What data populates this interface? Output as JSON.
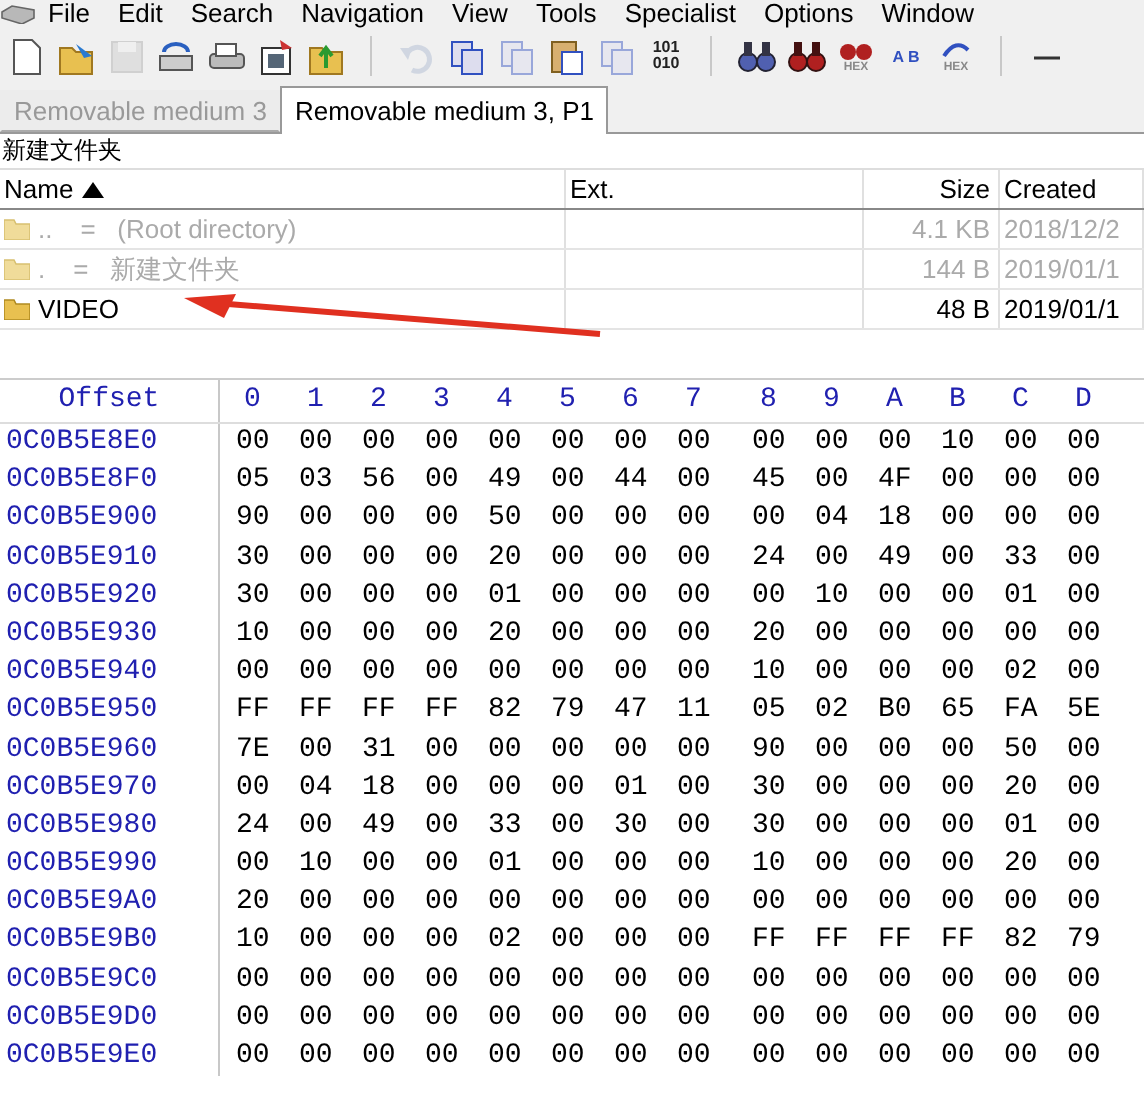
{
  "menu": [
    "File",
    "Edit",
    "Search",
    "Navigation",
    "View",
    "Tools",
    "Specialist",
    "Options",
    "Window"
  ],
  "toolbar": [
    {
      "kind": "new-file",
      "disabled": false
    },
    {
      "kind": "open-folder",
      "disabled": false
    },
    {
      "kind": "save",
      "disabled": true
    },
    {
      "kind": "disk",
      "disabled": false
    },
    {
      "kind": "print",
      "disabled": false
    },
    {
      "kind": "properties",
      "disabled": false
    },
    {
      "kind": "export-folder",
      "disabled": false
    },
    {
      "kind": "separator"
    },
    {
      "kind": "undo",
      "disabled": true
    },
    {
      "kind": "copy",
      "disabled": false
    },
    {
      "kind": "copy",
      "disabled": true
    },
    {
      "kind": "paste",
      "disabled": false
    },
    {
      "kind": "copy",
      "disabled": true
    },
    {
      "kind": "binary",
      "disabled": false,
      "label": "101 010"
    },
    {
      "kind": "separator"
    },
    {
      "kind": "find",
      "disabled": false
    },
    {
      "kind": "find-red",
      "disabled": false
    },
    {
      "kind": "find-hex",
      "disabled": false,
      "label": "HEX"
    },
    {
      "kind": "replace",
      "disabled": false,
      "label": "A B"
    },
    {
      "kind": "replace-hex",
      "disabled": false,
      "label": "HEX"
    },
    {
      "kind": "separator"
    },
    {
      "kind": "minus",
      "disabled": false
    }
  ],
  "tabs": [
    {
      "label": "Removable medium 3",
      "selected": false
    },
    {
      "label": "Removable medium 3, P1",
      "selected": true
    }
  ],
  "path": "新建文件夹",
  "dir_list": {
    "columns": [
      "Name",
      "Ext.",
      "Size",
      "Created"
    ],
    "rows": [
      {
        "name": "..",
        "description": "=   (Root directory)",
        "ext": "",
        "size": "4.1 KB",
        "created": "2018/12/2",
        "dimmed": true
      },
      {
        "name": ".",
        "description": "=   新建文件夹",
        "ext": "",
        "size": "144 B",
        "created": "2019/01/1",
        "dimmed": true
      },
      {
        "name": "VIDEO",
        "description": "",
        "ext": "",
        "size": "48 B",
        "created": "2019/01/1",
        "dimmed": false
      }
    ]
  },
  "hex": {
    "offset_label": "Offset",
    "columns": [
      "0",
      "1",
      "2",
      "3",
      "4",
      "5",
      "6",
      "7",
      "8",
      "9",
      "A",
      "B",
      "C",
      "D"
    ],
    "rows": [
      {
        "offset": "0C0B5E8E0",
        "bytes": [
          "00",
          "00",
          "00",
          "00",
          "00",
          "00",
          "00",
          "00",
          "00",
          "00",
          "00",
          "10",
          "00",
          "00"
        ]
      },
      {
        "offset": "0C0B5E8F0",
        "bytes": [
          "05",
          "03",
          "56",
          "00",
          "49",
          "00",
          "44",
          "00",
          "45",
          "00",
          "4F",
          "00",
          "00",
          "00"
        ]
      },
      {
        "offset": "0C0B5E900",
        "bytes": [
          "90",
          "00",
          "00",
          "00",
          "50",
          "00",
          "00",
          "00",
          "00",
          "04",
          "18",
          "00",
          "00",
          "00"
        ]
      },
      {
        "offset": "0C0B5E910",
        "bytes": [
          "30",
          "00",
          "00",
          "00",
          "20",
          "00",
          "00",
          "00",
          "24",
          "00",
          "49",
          "00",
          "33",
          "00"
        ]
      },
      {
        "offset": "0C0B5E920",
        "bytes": [
          "30",
          "00",
          "00",
          "00",
          "01",
          "00",
          "00",
          "00",
          "00",
          "10",
          "00",
          "00",
          "01",
          "00"
        ]
      },
      {
        "offset": "0C0B5E930",
        "bytes": [
          "10",
          "00",
          "00",
          "00",
          "20",
          "00",
          "00",
          "00",
          "20",
          "00",
          "00",
          "00",
          "00",
          "00"
        ]
      },
      {
        "offset": "0C0B5E940",
        "bytes": [
          "00",
          "00",
          "00",
          "00",
          "00",
          "00",
          "00",
          "00",
          "10",
          "00",
          "00",
          "00",
          "02",
          "00"
        ]
      },
      {
        "offset": "0C0B5E950",
        "bytes": [
          "FF",
          "FF",
          "FF",
          "FF",
          "82",
          "79",
          "47",
          "11",
          "05",
          "02",
          "B0",
          "65",
          "FA",
          "5E"
        ]
      },
      {
        "offset": "0C0B5E960",
        "bytes": [
          "7E",
          "00",
          "31",
          "00",
          "00",
          "00",
          "00",
          "00",
          "90",
          "00",
          "00",
          "00",
          "50",
          "00"
        ]
      },
      {
        "offset": "0C0B5E970",
        "bytes": [
          "00",
          "04",
          "18",
          "00",
          "00",
          "00",
          "01",
          "00",
          "30",
          "00",
          "00",
          "00",
          "20",
          "00"
        ]
      },
      {
        "offset": "0C0B5E980",
        "bytes": [
          "24",
          "00",
          "49",
          "00",
          "33",
          "00",
          "30",
          "00",
          "30",
          "00",
          "00",
          "00",
          "01",
          "00"
        ]
      },
      {
        "offset": "0C0B5E990",
        "bytes": [
          "00",
          "10",
          "00",
          "00",
          "01",
          "00",
          "00",
          "00",
          "10",
          "00",
          "00",
          "00",
          "20",
          "00"
        ]
      },
      {
        "offset": "0C0B5E9A0",
        "bytes": [
          "20",
          "00",
          "00",
          "00",
          "00",
          "00",
          "00",
          "00",
          "00",
          "00",
          "00",
          "00",
          "00",
          "00"
        ]
      },
      {
        "offset": "0C0B5E9B0",
        "bytes": [
          "10",
          "00",
          "00",
          "00",
          "02",
          "00",
          "00",
          "00",
          "FF",
          "FF",
          "FF",
          "FF",
          "82",
          "79"
        ]
      },
      {
        "offset": "0C0B5E9C0",
        "bytes": [
          "00",
          "00",
          "00",
          "00",
          "00",
          "00",
          "00",
          "00",
          "00",
          "00",
          "00",
          "00",
          "00",
          "00"
        ]
      },
      {
        "offset": "0C0B5E9D0",
        "bytes": [
          "00",
          "00",
          "00",
          "00",
          "00",
          "00",
          "00",
          "00",
          "00",
          "00",
          "00",
          "00",
          "00",
          "00"
        ]
      },
      {
        "offset": "0C0B5E9E0",
        "bytes": [
          "00",
          "00",
          "00",
          "00",
          "00",
          "00",
          "00",
          "00",
          "00",
          "00",
          "00",
          "00",
          "00",
          "00"
        ]
      }
    ]
  }
}
